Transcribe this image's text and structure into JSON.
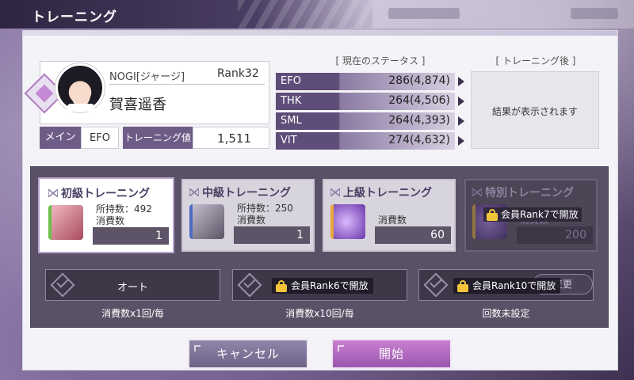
{
  "header": {
    "title": "トレーニング"
  },
  "character": {
    "affiliation": "NOGI[ジャージ]",
    "rank": "Rank32",
    "name": "賀喜遥香",
    "main_label": "メイン",
    "main_value": "EFO",
    "training_value_label": "トレーニング値",
    "training_value": "1,511"
  },
  "status": {
    "current_header": "[ 現在のステータス ]",
    "after_header": "[ トレーニング後 ]",
    "after_placeholder": "結果が表示されます",
    "rows": [
      {
        "label": "EFO",
        "value": "286(4,874)"
      },
      {
        "label": "THK",
        "value": "264(4,506)"
      },
      {
        "label": "SML",
        "value": "264(4,393)"
      },
      {
        "label": "VIT",
        "value": "274(4,632)"
      }
    ]
  },
  "training": [
    {
      "title": "初級トレーニング",
      "owned": "所持数：492",
      "cost_label": "消費数",
      "cost": "1",
      "selected": true,
      "icon_color": "#c9707e"
    },
    {
      "title": "中級トレーニング",
      "owned": "所持数：250",
      "cost_label": "消費数",
      "cost": "1",
      "selected": false,
      "icon_color": "#8c8494"
    },
    {
      "title": "上級トレーニング",
      "owned": "",
      "cost_label": "消費数",
      "cost": "60",
      "selected": false,
      "icon_color": "#8c5ccc"
    },
    {
      "title": "特別トレーニング",
      "owned": "",
      "cost_label": "消費数",
      "cost": "200",
      "selected": false,
      "icon_color": "#7a4fb0"
    }
  ],
  "locks": {
    "special": "会員Rank7で開放",
    "x10": "会員Rank6で開放",
    "custom": "会員Rank10で開放"
  },
  "modes": {
    "auto_label": "オート",
    "auto_caption": "消費数x1回/毎",
    "x10_caption": "消費数x10回/毎",
    "custom_caption": "回数未設定",
    "change_label": "変更"
  },
  "buttons": {
    "cancel": "キャンセル",
    "start": "開始"
  }
}
